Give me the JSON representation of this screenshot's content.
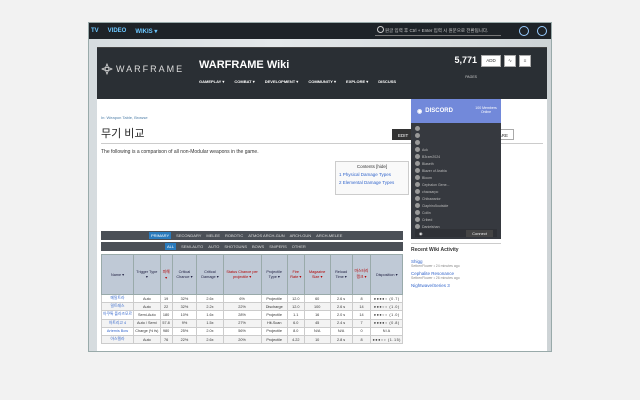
{
  "topbar": {
    "nav": [
      "TV",
      "VIDEO",
      "WIKIS ▾"
    ],
    "search_placeholder": "원글 입력 후 Ctrl + Enter 입력 시 원문으로 전환됩니다."
  },
  "header": {
    "logo": "WARFRAME",
    "title": "WARFRAME Wiki",
    "nav": [
      "GAMEPLAY ▾",
      "COMBAT ▾",
      "DEVELOPMENT ▾",
      "COMMUNITY ▾",
      "EXPLORE ▾",
      "DISCUSS"
    ],
    "pages_count": "5,771",
    "pages_label": "PAGES",
    "add_label": "ADD"
  },
  "page": {
    "breadcrumb": "In: Weapon Table, Browse",
    "title": "무기 비교",
    "edit": "EDIT",
    "comments": "COMMENTS (509)",
    "share": "SHARE",
    "intro": "The following is a comparison of all non-Modular weapons in the game."
  },
  "toc": {
    "title": "Contents [hide]",
    "items": [
      "1 Physical Damage Types",
      "2 Elemental Damage Types"
    ]
  },
  "discord": {
    "title": "DISCORD",
    "members": "100 Members Online",
    "users": [
      "",
      "",
      " ",
      "Ack",
      "B3rzer2024",
      "Blaseth",
      "Blazer of Arabia",
      "Bloom",
      "Cephalon Gene...",
      "chaosarpo",
      "Chibawarior",
      "Ciaphiro5outside",
      "Collin",
      "Cribed",
      "Danielshan"
    ],
    "connect": "Connect"
  },
  "activity": {
    "title": "Recent Wiki Activity",
    "items": [
      {
        "name": "Shigg",
        "meta": "SetbenFlower • 24 minutes ago"
      },
      {
        "name": "Cephalite Resonance",
        "meta": "SetbenFlower • 26 minutes ago"
      },
      {
        "name": "Nightwave/Series 3",
        "meta": ""
      }
    ]
  },
  "tabs1": [
    "PRIMARY",
    "SECONDARY",
    "MELEE",
    "ROBOTIC",
    "ATMOS ARCH-GUN",
    "ARCH-GUN",
    "ARCH-MELEE"
  ],
  "tabs2": [
    "ALL",
    "SEMI-AUTO",
    "AUTO",
    "SHOTGUNS",
    "BOWS",
    "SNIPERS",
    "OTHER"
  ],
  "table": {
    "headers": [
      "Name ▾",
      "Trigger Type ▾",
      "피해 ▾",
      "Critical Chance ▾",
      "Critical Damage ▾",
      "Status Chance per projectile ▾",
      "Projectile Type ▾",
      "Fire Rate ▾",
      "Magazine Size ▾",
      "Reload Time ▾",
      "마스터리 랭크 ▾",
      "Disposition ▾"
    ],
    "rows": [
      [
        "메탈트라",
        "Auto",
        "19",
        "32%",
        "2.6x",
        "6%",
        "Projectile",
        "12.0",
        "60",
        "2.6 s",
        "8",
        "●●●●○ (0.7)"
      ],
      [
        "밀트레스",
        "Auto",
        "22",
        "32%",
        "2.2x",
        "22%",
        "Discharge",
        "12.0",
        "100",
        "2.6 s",
        "14",
        "●●●○○ (1.0)"
      ],
      [
        "아쿠톡 플라즈모르",
        "Semi-Auto",
        "180",
        "10%",
        "1.6x",
        "28%",
        "Projectile",
        "1.1",
        "16",
        "2.0 s",
        "14",
        "●●●○○ (1.0)"
      ],
      [
        "아트리고 4",
        "Auto / Semi",
        "57.8",
        "9%",
        "1.5x",
        "27%",
        "Hit-Scan",
        "6.0",
        "45",
        "2.4 s",
        "7",
        "●●●●○ (0.8)"
      ],
      [
        "Artemis Bow",
        "Charge (½ fs)",
        "980",
        "25%",
        "2.0x",
        "56%",
        "Projectile",
        "8.0",
        "N/A",
        "N/A",
        "0",
        "N/A"
      ],
      [
        "아스텔라",
        "Auto",
        "76",
        "22%",
        "2.6x",
        "20%",
        "Projectile",
        "4.22",
        "10",
        "2.8 s",
        "8",
        "●●●○○ (1.15)"
      ]
    ]
  }
}
